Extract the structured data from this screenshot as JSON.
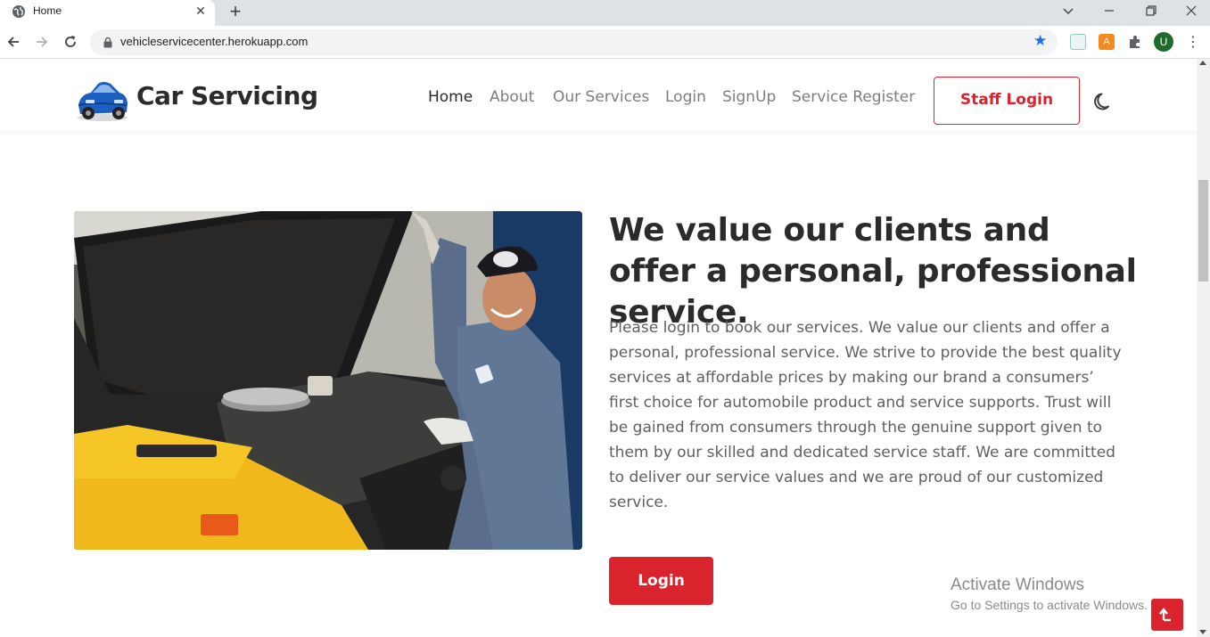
{
  "browser": {
    "tab_title": "Home",
    "tab_close": "✕",
    "new_tab": "+",
    "url": "vehicleservicecenter.herokuapp.com",
    "profile_initial": "U",
    "window_controls": [
      "chevron-down-icon",
      "minimize-icon",
      "restore-icon",
      "close-icon"
    ]
  },
  "header": {
    "brand": "Car Servicing",
    "nav": [
      "Home",
      "About",
      "Our Services",
      "Login",
      "SignUp",
      "Service Register"
    ],
    "active_nav": "Home",
    "staff_login": "Staff Login"
  },
  "hero": {
    "headline": "We value our clients and offer a personal, professional service.",
    "paragraph": "Please login to book our services. We value our clients and offer a personal, professional service. We strive to provide the best quality services at affordable prices by making our brand a consumers’ first choice for automobile product and service supports. Trust will be gained from consumers through the genuine support given to them by our skilled and dedicated service staff. We are committed to deliver our service values and we are proud of our customized service.",
    "login_button": "Login"
  },
  "watermark": {
    "line1": "Activate Windows",
    "line2": "Go to Settings to activate Windows."
  },
  "colors": {
    "accent": "#d9232d",
    "text_dark": "#2b2b2b",
    "text_muted": "#7d7d7d"
  }
}
